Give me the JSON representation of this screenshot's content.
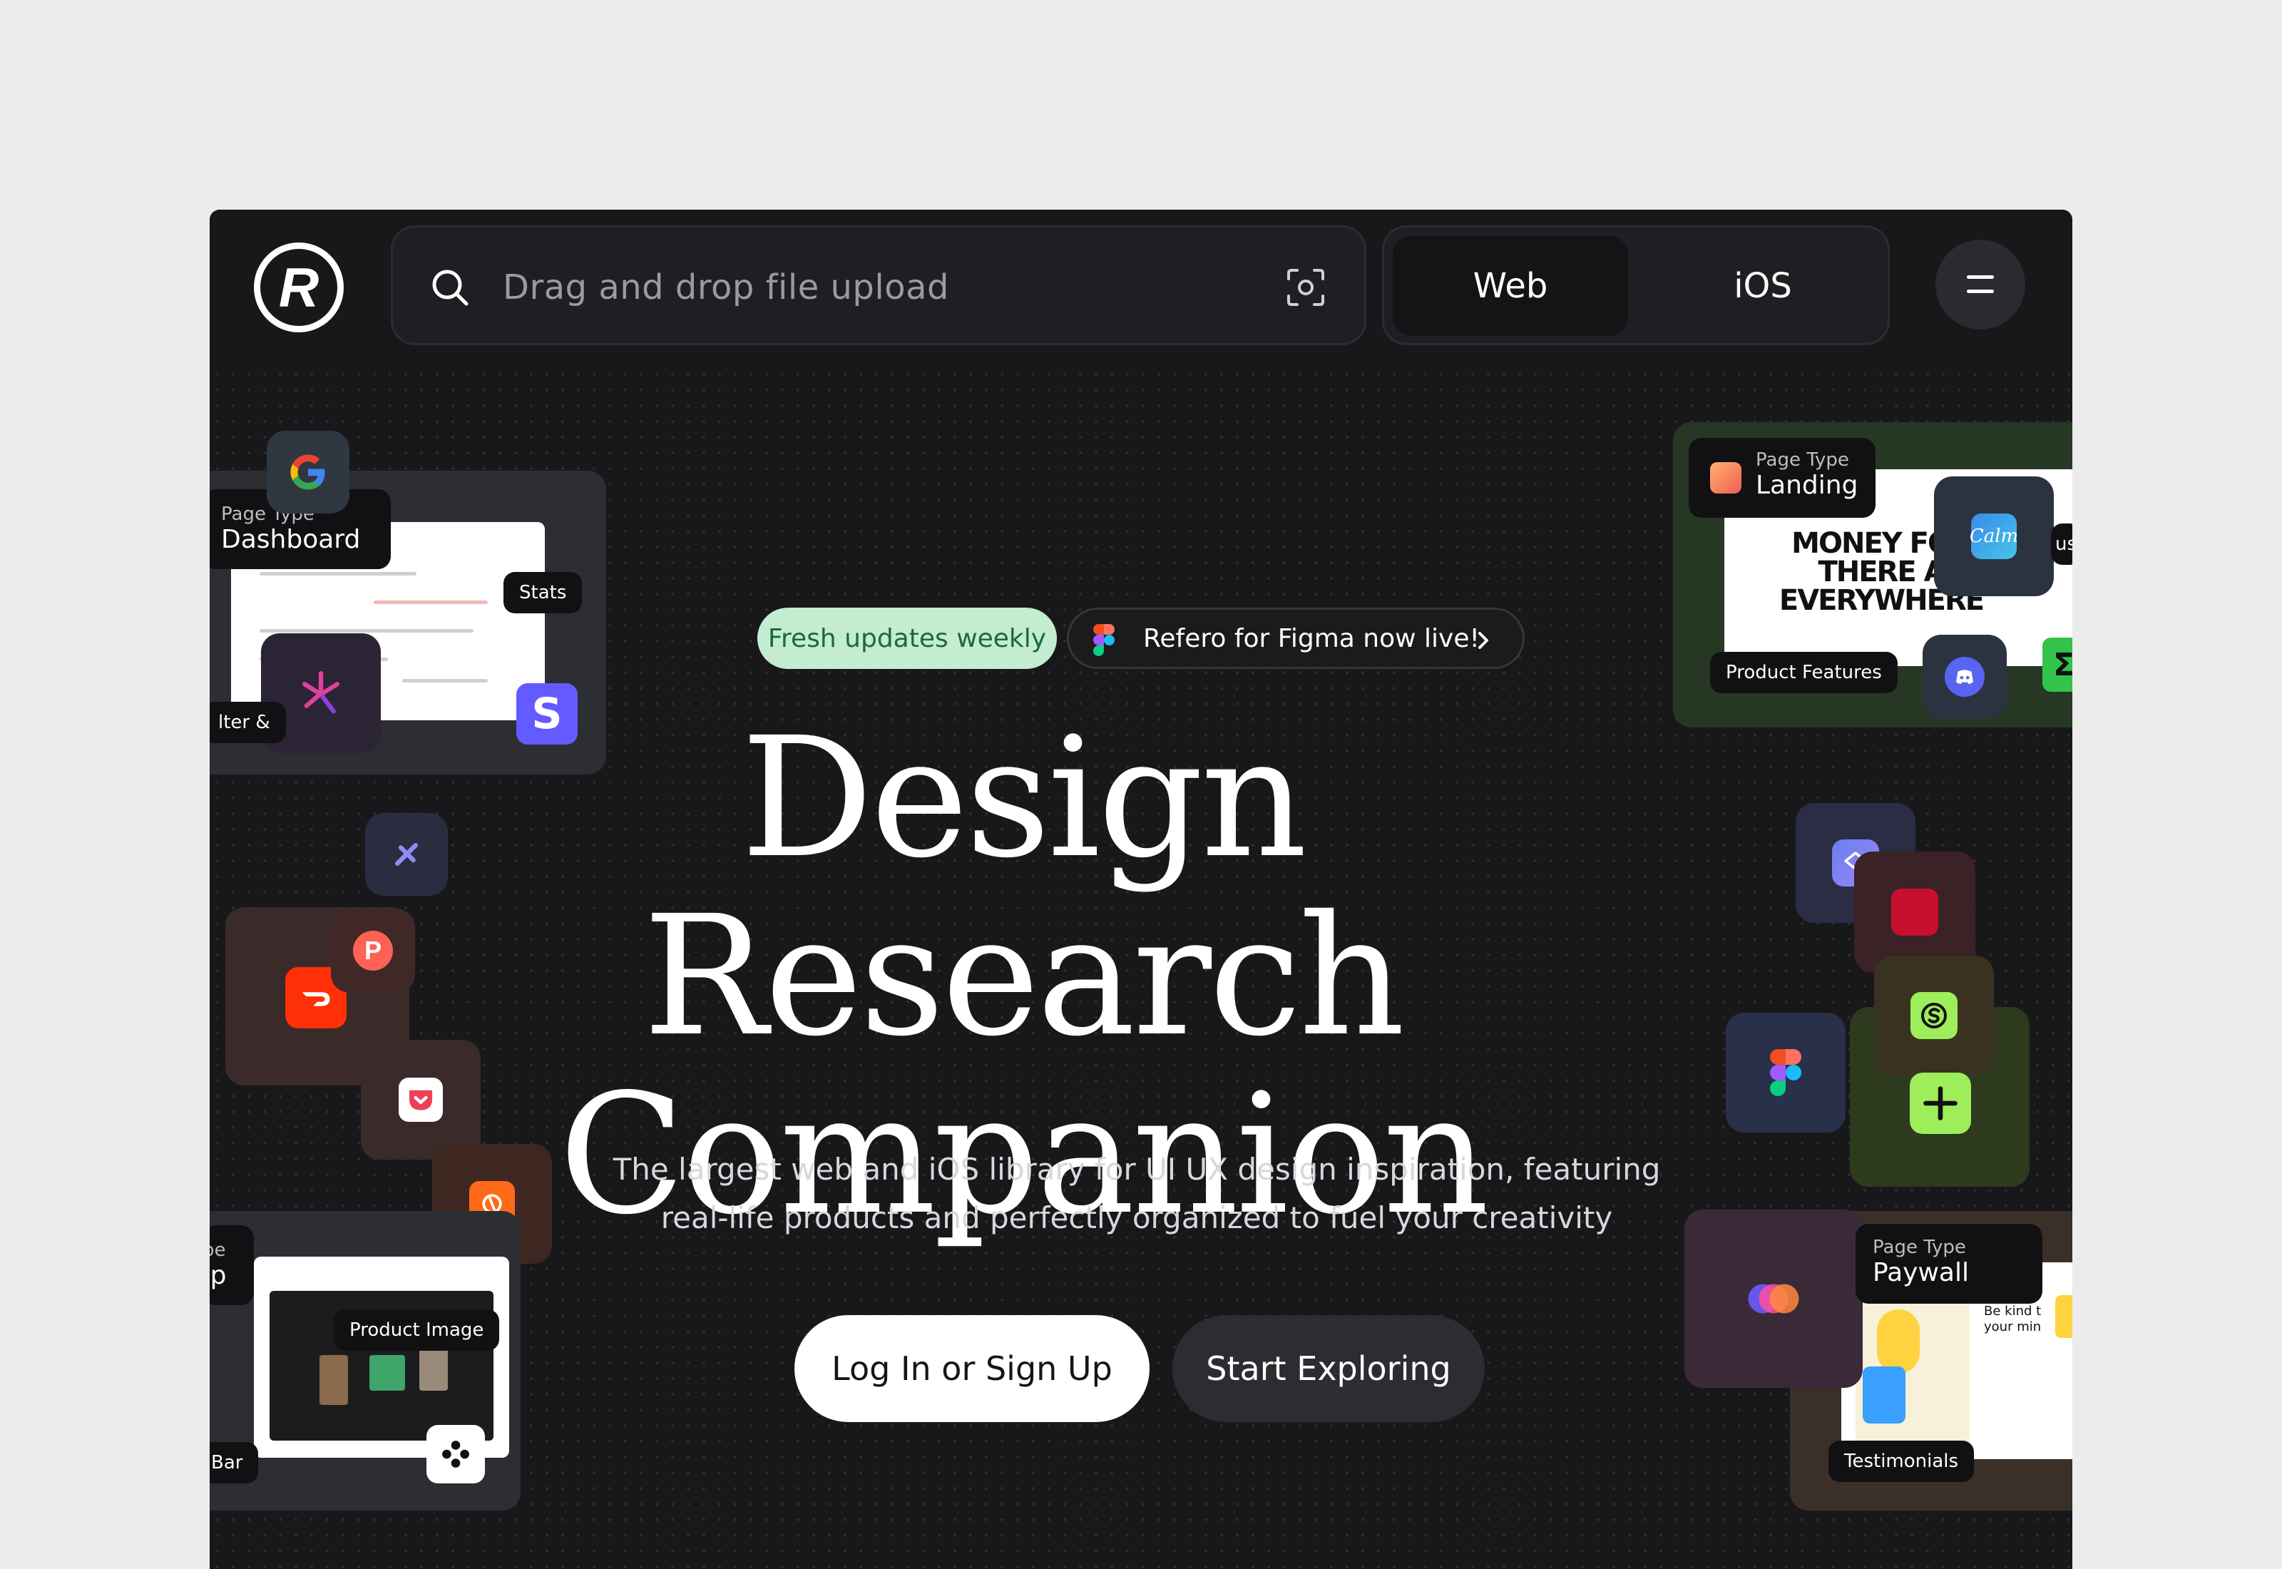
{
  "header": {
    "search_placeholder": "Drag and drop file upload",
    "tabs": [
      {
        "label": "Web",
        "active": true
      },
      {
        "label": "iOS",
        "active": false
      }
    ]
  },
  "announcements": {
    "fresh": "Fresh updates weekly",
    "figma": "Refero for Figma now live!"
  },
  "hero": {
    "title_line1": "Design Research",
    "title_line2": "Companion",
    "subtitle_line1": "The largest web and iOS library for UI UX design inspiration, featuring",
    "subtitle_line2": "real-life products and perfectly organized to fuel your creativity"
  },
  "actions": {
    "login": "Log In or Sign Up",
    "explore": "Start Exploring"
  },
  "collage": {
    "dashboard": {
      "type_label": "Page Type",
      "type_value": "Dashboard",
      "tag": "Stats",
      "edge_text": "lter &"
    },
    "landing": {
      "type_label": "Page Type",
      "type_value": "Landing",
      "tag": "Product Features",
      "headline": "MONEY FOR THERE A EVERYWHERE",
      "edge_text": "us"
    },
    "signup": {
      "type_label": "pe",
      "type_value": "Jp",
      "tag": "Product Image",
      "edge_tag": "Bar"
    },
    "paywall": {
      "type_label": "Page Type",
      "type_value": "Paywall",
      "tag": "Testimonials",
      "snippet": "Be kind t your min"
    }
  },
  "icons": {
    "brand_text": {
      "stripe": "S",
      "producthunt": "P"
    }
  },
  "colors": {
    "background": "#18181b",
    "page": "#ececec",
    "accent_green": "#c4ecd0",
    "button_light": "#ffffff"
  }
}
